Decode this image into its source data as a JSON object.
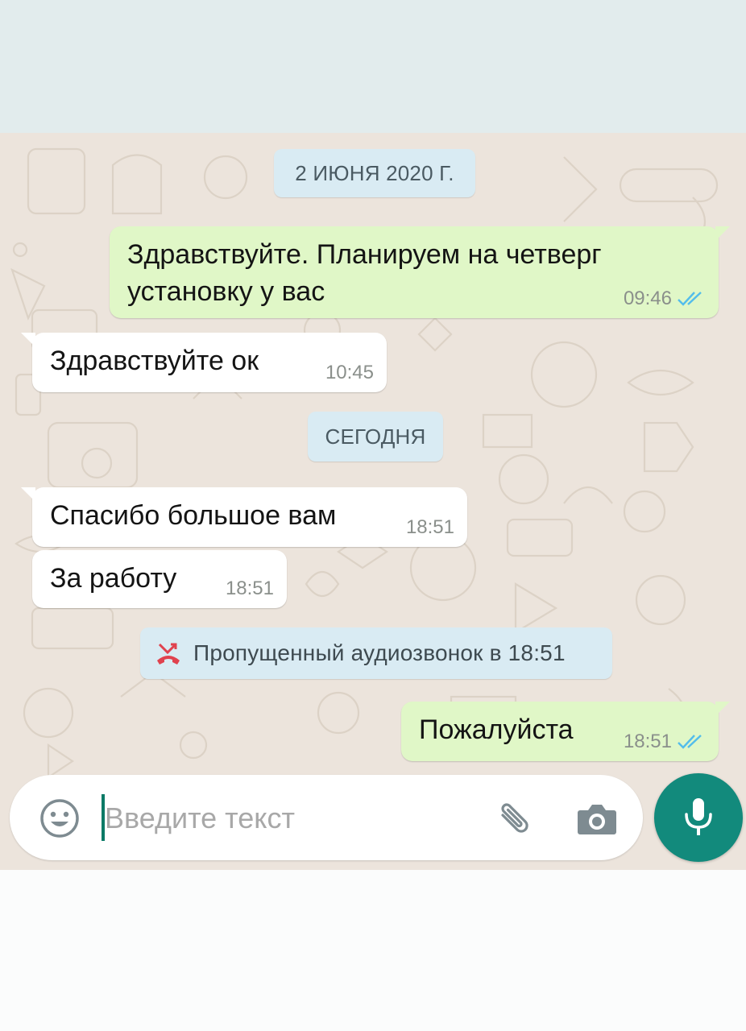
{
  "colors": {
    "chat_background": "#ece4dc",
    "outgoing_bubble": "#e0f7c7",
    "incoming_bubble": "#ffffff",
    "date_pill": "#d9ebf3",
    "read_ticks": "#53bdeb",
    "missed_call_icon": "#e0424e",
    "mic_button": "#128a7c"
  },
  "date_separators": {
    "first": "2 ИЮНЯ 2020 Г.",
    "second": "СЕГОДНЯ"
  },
  "messages": [
    {
      "direction": "out",
      "lines": [
        "Здравствуйте. Планируем на четверг",
        "установку у вас"
      ],
      "time": "09:46",
      "status": "read"
    },
    {
      "direction": "in",
      "text": "Здравствуйте ок",
      "time": "10:45"
    },
    {
      "direction": "in",
      "text": "Спасибо большое вам",
      "time": "18:51"
    },
    {
      "direction": "in",
      "text": "За работу",
      "time": "18:51"
    },
    {
      "direction": "out",
      "text": "Пожалуйста",
      "time": "18:51",
      "status": "read"
    }
  ],
  "missed_call": {
    "text": "Пропущенный аудиозвонок в 18:51",
    "icon": "missed-call-icon"
  },
  "composer": {
    "placeholder": "Введите текст",
    "icons": [
      "emoji-icon",
      "attach-icon",
      "camera-icon",
      "mic-icon"
    ]
  }
}
